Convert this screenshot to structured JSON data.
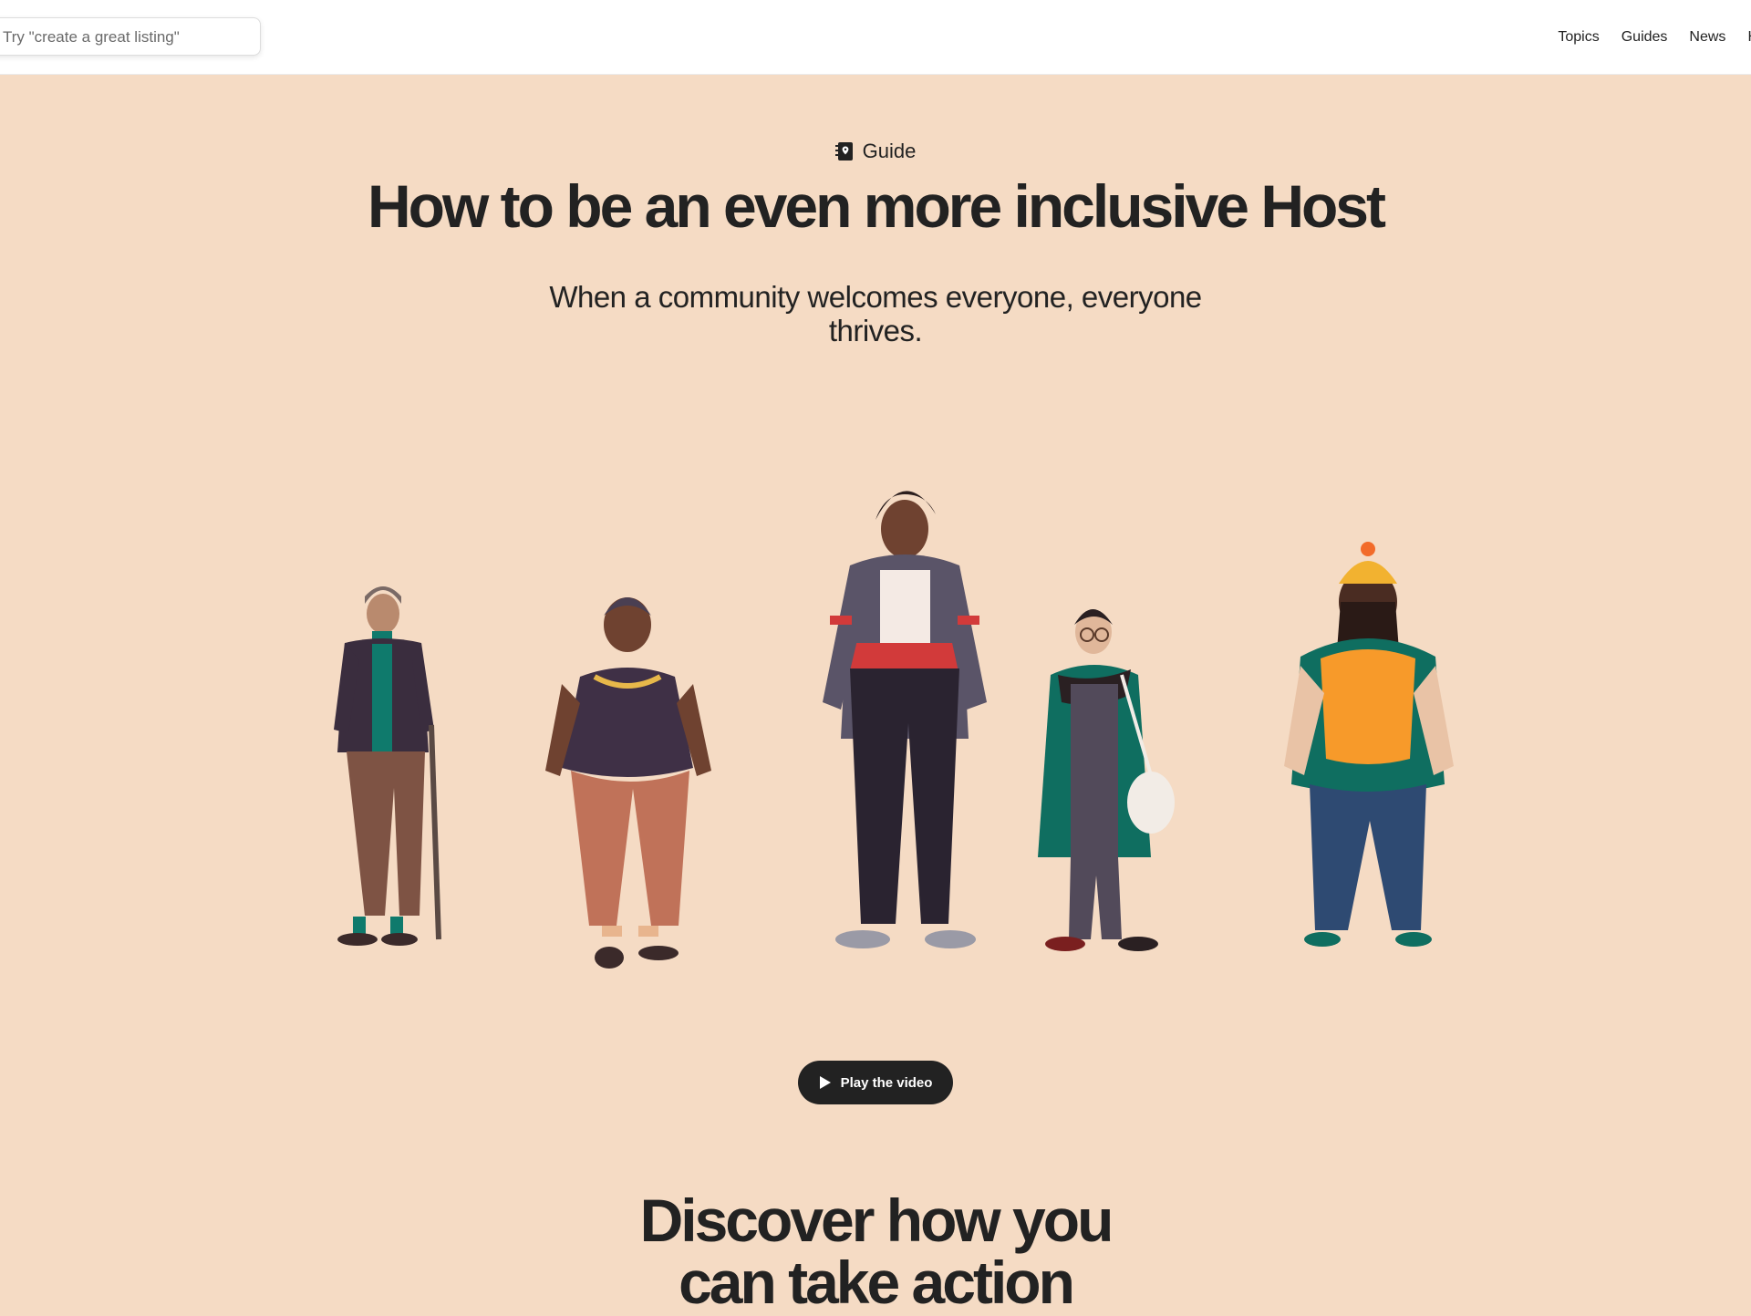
{
  "header": {
    "search_placeholder": "Try \"create a great listing\"",
    "nav": [
      "Topics",
      "Guides",
      "News",
      "H"
    ]
  },
  "hero": {
    "eyebrow": "Guide",
    "title": "How to be an even more inclusive Host",
    "subtitle": "When a community welcomes everyone, everyone thrives.",
    "play_button": "Play the video",
    "background_color": "#f5dbc4"
  },
  "section": {
    "title_line1": "Discover how you",
    "title_line2": "can take action"
  }
}
